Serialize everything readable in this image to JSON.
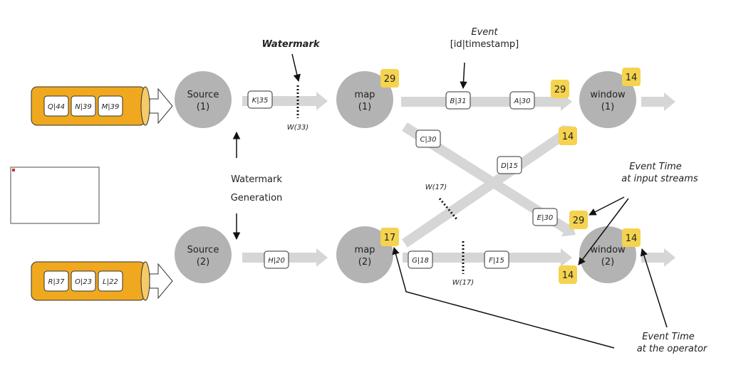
{
  "colors": {
    "stream": "#d6d6d6",
    "operator": "#b3b3b3",
    "badge": "#f5d34f",
    "queue": "#f0a81e",
    "text": "#222222"
  },
  "sources": [
    {
      "label": "Source",
      "idx": "(1)",
      "queue": [
        "Q|44",
        "N|39",
        "M|39"
      ]
    },
    {
      "label": "Source",
      "idx": "(2)",
      "queue": [
        "R|37",
        "O|23",
        "L|22"
      ]
    }
  ],
  "maps": [
    {
      "label": "map",
      "idx": "(1)"
    },
    {
      "label": "map",
      "idx": "(2)"
    }
  ],
  "windows": [
    {
      "label": "window",
      "idx": "(1)"
    },
    {
      "label": "window",
      "idx": "(2)"
    }
  ],
  "events": {
    "k": "K|35",
    "h": "H|20",
    "b": "B|31",
    "a": "A|30",
    "c": "C|30",
    "d": "D|15",
    "e": "E|30",
    "g": "G|18",
    "f": "F|15"
  },
  "watermarks": {
    "w33": "W(33)",
    "w17_diag": "W(17)",
    "w17_bottom": "W(17)"
  },
  "badges": {
    "map1": "29",
    "map2": "17",
    "win1_op": "14",
    "win1_in_top": "29",
    "win1_in_cross": "14",
    "win2_op": "14",
    "win2_in_cross": "29",
    "win2_in_bottom": "14"
  },
  "annotations": {
    "watermark": "Watermark",
    "event_title": "Event",
    "event_format": "[id|timestamp]",
    "generation_line1": "Watermark",
    "generation_line2": "Generation",
    "input_time_line1": "Event Time",
    "input_time_line2": "at input streams",
    "operator_time_line1": "Event Time",
    "operator_time_line2": "at the operator"
  },
  "broken_image": {
    "icon": "broken-image-icon"
  }
}
